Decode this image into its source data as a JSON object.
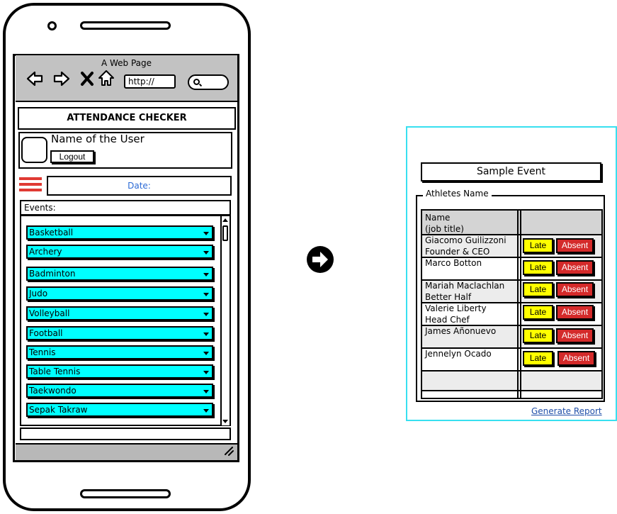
{
  "browser": {
    "title": "A Web Page",
    "url_placeholder": "http://"
  },
  "app": {
    "title": "ATTENDANCE CHECKER",
    "user_name": "Name of the User",
    "logout_label": "Logout",
    "date_label": "Date:",
    "events_label": "Events:",
    "events": [
      "Basketball",
      "Archery",
      "Badminton",
      "Judo",
      "Volleyball",
      "Football",
      "Tennis",
      "Table Tennis",
      "Taekwondo",
      "Sepak Takraw"
    ]
  },
  "panel": {
    "event_title": "Sample Event",
    "group_label": "Athletes Name",
    "header_line1": "Name",
    "header_line2": "(job title)",
    "late_label": "Late",
    "absent_label": "Absent",
    "athletes": [
      {
        "name": "Giacomo Guilizzoni",
        "title": "Founder & CEO"
      },
      {
        "name": "Marco Botton",
        "title": ""
      },
      {
        "name": "Mariah Maclachlan",
        "title": "Better Half"
      },
      {
        "name": "Valerie Liberty",
        "title": "Head Chef"
      },
      {
        "name": "James Añonuevo",
        "title": ""
      },
      {
        "name": "Jennelyn Ocado",
        "title": ""
      }
    ],
    "generate_report_label": "Generate Report"
  },
  "colors": {
    "event_fill": "#00ffff",
    "late_fill": "#ffff00",
    "absent_fill": "#d42a2a",
    "menu_red": "#e03a33",
    "link_blue": "#1f4ea8",
    "panel_border": "#38e0f0"
  }
}
